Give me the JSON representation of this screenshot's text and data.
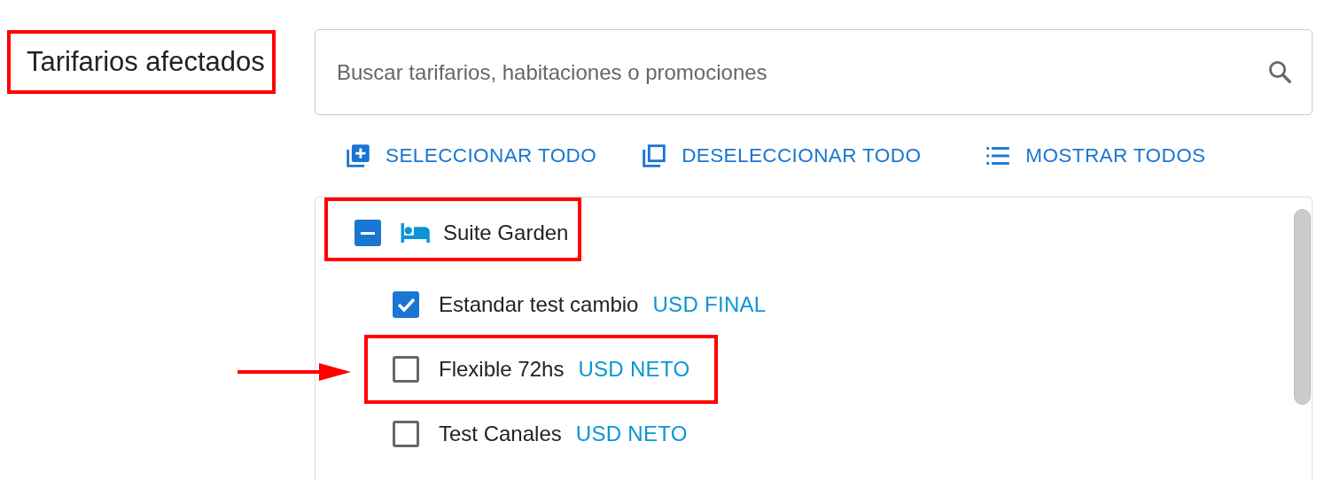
{
  "section_title": {
    "text": "Tarifarios afectados",
    "highlighted": true
  },
  "search": {
    "placeholder": "Buscar tarifarios, habitaciones o promociones"
  },
  "actions": [
    {
      "kind": "select-all",
      "label": "SELECCIONAR TODO"
    },
    {
      "kind": "deselect-all",
      "label": "DESELECCIONAR TODO"
    },
    {
      "kind": "show-all",
      "label": "MOSTRAR TODOS"
    }
  ],
  "groups": [
    {
      "name": "Suite Garden",
      "indeterminate": true,
      "highlighted": true,
      "children": [
        {
          "name": "Estandar test cambio",
          "currency": "USD FINAL",
          "checked": true,
          "highlighted": false,
          "arrow": false
        },
        {
          "name": "Flexible 72hs",
          "currency": "USD NETO",
          "checked": false,
          "highlighted": true,
          "arrow": true
        },
        {
          "name": "Test Canales",
          "currency": "USD NETO",
          "checked": false,
          "highlighted": false,
          "arrow": false
        }
      ]
    }
  ]
}
